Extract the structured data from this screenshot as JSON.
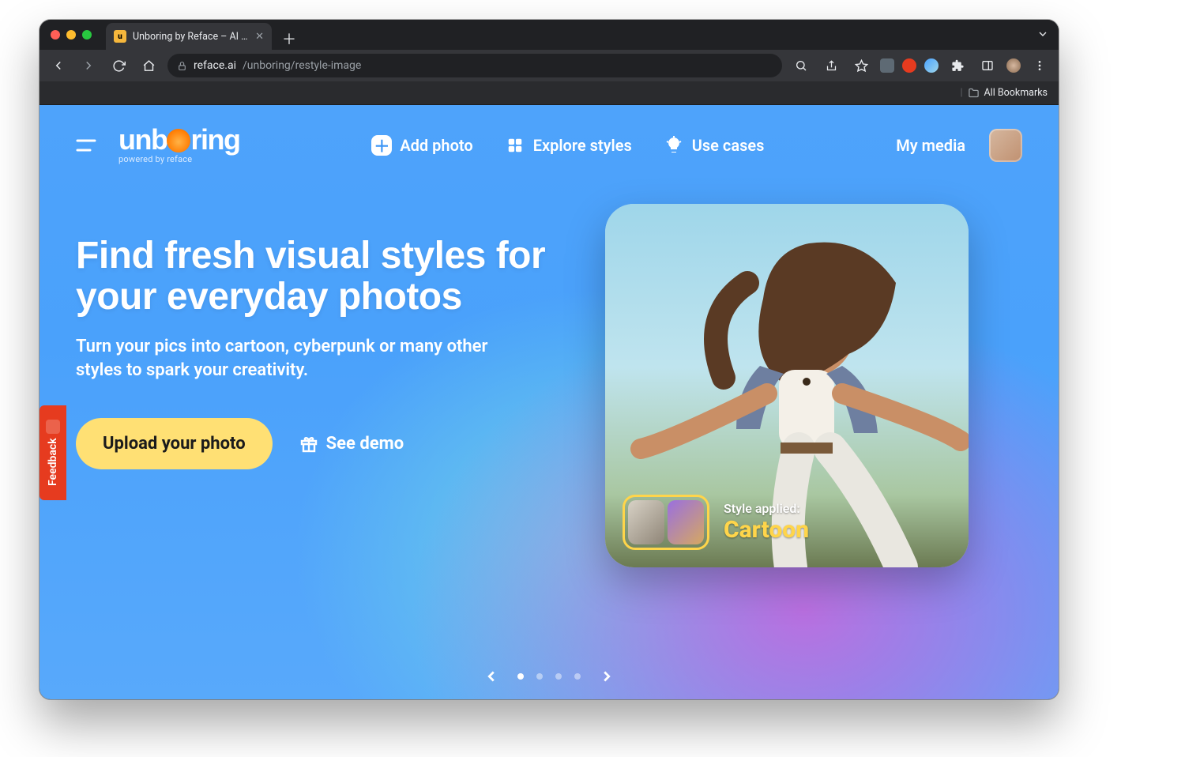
{
  "browser": {
    "tab_title": "Unboring by Reface – AI Phot…",
    "url_host": "reface.ai",
    "url_path": "/unboring/restyle-image",
    "bookmarks_label": "All Bookmarks"
  },
  "feedback_label": "Feedback",
  "brand": {
    "name": "unboring",
    "tagline": "powered by reface"
  },
  "nav": {
    "add_photo": "Add photo",
    "explore": "Explore styles",
    "use_cases": "Use cases",
    "my_media": "My media"
  },
  "hero": {
    "heading": "Find fresh visual styles for your everyday photos",
    "subheading": "Turn your pics into cartoon, cyberpunk or many other styles to spark your creativity.",
    "cta_primary": "Upload your photo",
    "cta_secondary": "See demo"
  },
  "preview": {
    "style_label": "Style applied:",
    "style_value": "Cartoon"
  },
  "carousel": {
    "count": 4,
    "active": 0
  }
}
